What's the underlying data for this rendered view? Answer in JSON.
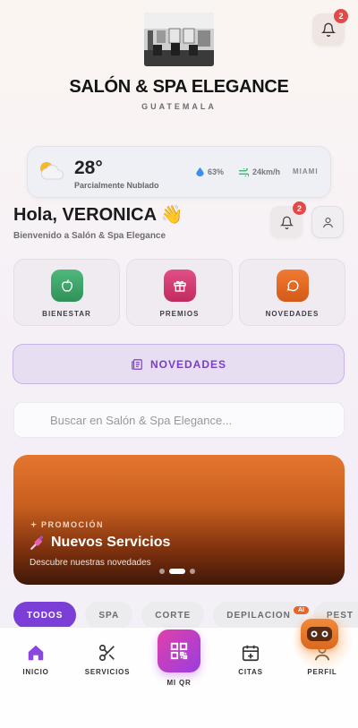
{
  "header": {
    "brand_title": "SALÓN & SPA ELEGANCE",
    "brand_subtitle": "GUATEMALA",
    "notification_count": "2"
  },
  "weather": {
    "temperature": "28°",
    "description": "Parcialmente Nublado",
    "humidity": "63%",
    "wind": "24km/h",
    "city": "MIAMI"
  },
  "greeting": {
    "hello": "Hola, VERONICA 👋",
    "welcome": "Bienvenido a Salón & Spa Elegance",
    "notification_count": "2"
  },
  "quick_actions": [
    {
      "label": "BIENESTAR",
      "icon": "apple-icon",
      "color": "#3aa56a"
    },
    {
      "label": "PREMIOS",
      "icon": "gift-icon",
      "color": "#d6336c"
    },
    {
      "label": "NOVEDADES",
      "icon": "chat-bubble-icon",
      "color": "#e8641e"
    }
  ],
  "novedades_button": {
    "label": "NOVEDADES",
    "icon": "newspaper-icon"
  },
  "search": {
    "placeholder": "Buscar en Salón & Spa Elegance..."
  },
  "promo": {
    "tag": "PROMOCIÓN",
    "title": "Nuevos Servicios",
    "subtitle": "Descubre nuestras novedades",
    "active_slide": 2,
    "total_slides": 3
  },
  "categories": [
    "TODOS",
    "SPA",
    "CORTE",
    "DEPILACION",
    "PEST"
  ],
  "active_category": "TODOS",
  "bottom_nav": {
    "inicio": "INICIO",
    "servicios": "SERVICIOS",
    "mi_qr": "MI QR",
    "citas": "CITAS",
    "perfil": "PERFIL"
  },
  "assistant": {
    "badge": "AI"
  },
  "colors": {
    "accent": "#7b3fd8",
    "badge": "#e14a48",
    "promo": "#e4762f"
  }
}
